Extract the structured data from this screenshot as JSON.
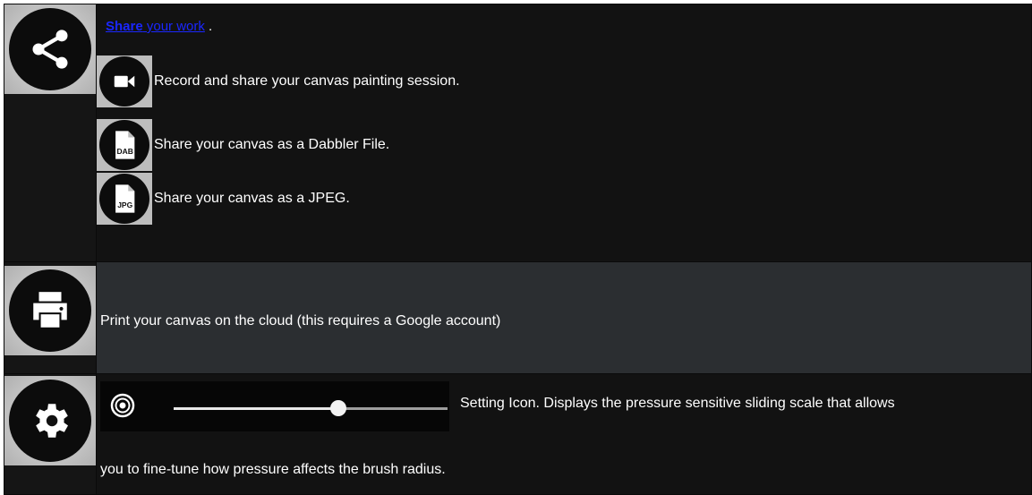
{
  "share": {
    "title_link_bold": "Share",
    "title_link_rest": " your work",
    "title_suffix": " .",
    "items": [
      {
        "icon": "videocam-icon",
        "text": "Record and share your canvas painting session."
      },
      {
        "icon": "dab-file-icon",
        "badge": "DAB",
        "text": "Share your canvas as a Dabbler File."
      },
      {
        "icon": "jpg-file-icon",
        "badge": "JPG",
        "text": "Share your canvas as a JPEG."
      }
    ]
  },
  "print": {
    "icon": "print-icon",
    "text": "Print your canvas on the cloud (this requires a Google account)"
  },
  "settings": {
    "icon": "gear-icon",
    "slider_value": 0.6,
    "text_line1": "Setting Icon. Displays the pressure sensitive sliding scale that allows",
    "text_line2": "you to fine-tune how pressure affects the brush radius."
  },
  "colors": {
    "link": "#1a27ff",
    "row_dark": "#121212",
    "row_print": "#2b2e31"
  }
}
